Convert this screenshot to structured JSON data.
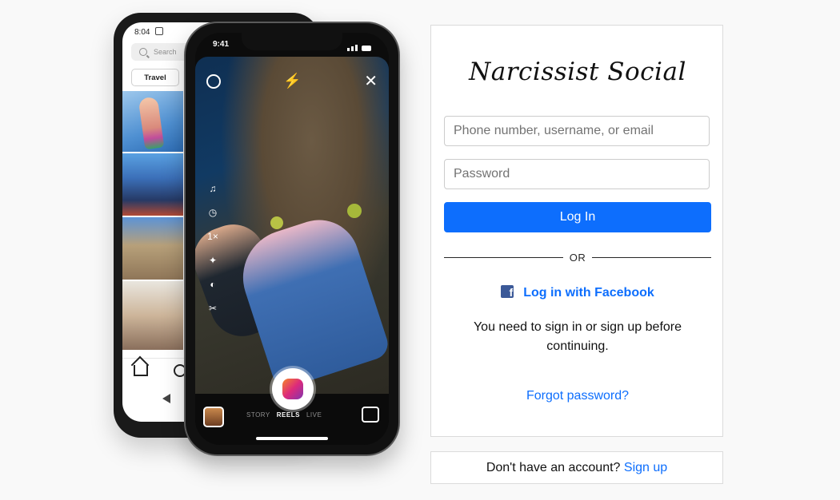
{
  "phones": {
    "back": {
      "time": "8:04",
      "search_placeholder": "Search",
      "chip_label": "Travel"
    },
    "front": {
      "time": "9:41",
      "modes": [
        "STORY",
        "REELS",
        "LIVE"
      ],
      "active_mode": "REELS"
    }
  },
  "login": {
    "brand": "Narcissist Social",
    "username_placeholder": "Phone number, username, or email",
    "password_placeholder": "Password",
    "login_button": "Log In",
    "or_text": "OR",
    "facebook_label": "Log in with Facebook",
    "notice": "You need to sign in or sign up before continuing.",
    "forgot_label": "Forgot password?"
  },
  "signup": {
    "prompt": "Don't have an account?",
    "link": "Sign up"
  },
  "colors": {
    "accent": "#0d6efd",
    "facebook": "#3b5998",
    "border": "#dbdbdb",
    "background": "#f9f9f9"
  }
}
